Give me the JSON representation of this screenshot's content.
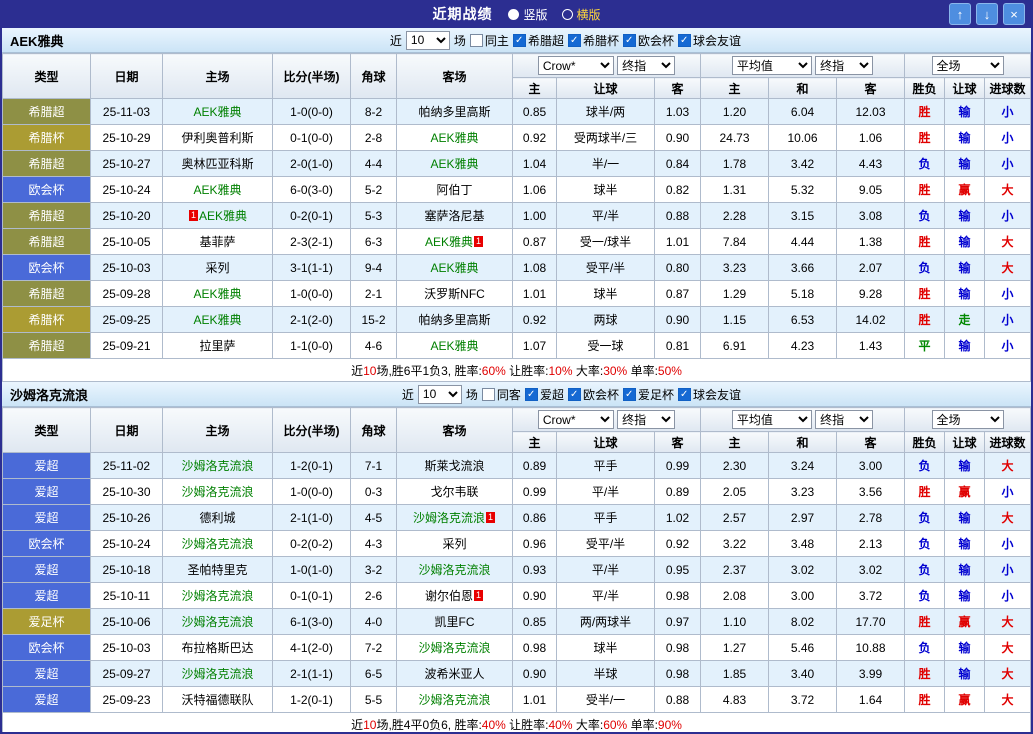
{
  "titlebar": {
    "title": "近期战绩",
    "vertical": "竖版",
    "horizontal": "横版",
    "up_icon": "↑",
    "down_icon": "↓",
    "close_icon": "×"
  },
  "table_header": {
    "cols": [
      "类型",
      "日期",
      "主场",
      "比分(半场)",
      "角球",
      "客场"
    ],
    "sub": [
      "主",
      "让球",
      "客",
      "主",
      "和",
      "客",
      "胜负",
      "让球",
      "进球数"
    ],
    "selects": {
      "crow": "Crow*",
      "final1": "终指",
      "avg": "平均值",
      "final2": "终指",
      "full": "全场"
    }
  },
  "colors": {
    "titlebar": "#2c2e91",
    "league_olive": "#8e9045",
    "league_gold": "#ab9c33",
    "league_blue": "#4a6ad8",
    "focal_team": "#008000",
    "win_red": "#e00000",
    "loss_blue": "#0000d0",
    "draw_green": "#008800"
  },
  "sections": [
    {
      "team": "AEK雅典",
      "filter": {
        "near": "近",
        "count": "10",
        "games": "场",
        "same": "同主",
        "leagues": [
          "希腊超",
          "希腊杯",
          "欧会杯",
          "球会友谊"
        ]
      },
      "rows": [
        {
          "type": "希腊超",
          "tc": "t-olive",
          "date": "25-11-03",
          "home": "AEK雅典",
          "hc": "focal",
          "score": "1-0(0-0)",
          "corners": "8-2",
          "away": "帕纳多里高斯",
          "h": "0.85",
          "hcap": "球半/两",
          "a": "1.03",
          "m1": "1.20",
          "m2": "6.04",
          "m3": "12.03",
          "r": "胜",
          "rc": "res-r",
          "l": "输",
          "lc": "res-b",
          "g": "小",
          "gc": "res-b"
        },
        {
          "type": "希腊杯",
          "tc": "t-gold",
          "date": "25-10-29",
          "home": "伊利奥普利斯",
          "score": "0-1(0-0)",
          "corners": "2-8",
          "away": "AEK雅典",
          "ac": "focal",
          "h": "0.92",
          "hcap": "受两球半/三",
          "a": "0.90",
          "m1": "24.73",
          "m2": "10.06",
          "m3": "1.06",
          "r": "胜",
          "rc": "res-r",
          "l": "输",
          "lc": "res-b",
          "g": "小",
          "gc": "res-b"
        },
        {
          "type": "希腊超",
          "tc": "t-olive",
          "date": "25-10-27",
          "home": "奥林匹亚科斯",
          "score": "2-0(1-0)",
          "corners": "4-4",
          "away": "AEK雅典",
          "ac": "focal",
          "h": "1.04",
          "hcap": "半/一",
          "a": "0.84",
          "m1": "1.78",
          "m2": "3.42",
          "m3": "4.43",
          "r": "负",
          "rc": "res-b",
          "l": "输",
          "lc": "res-b",
          "g": "小",
          "gc": "res-b"
        },
        {
          "type": "欧会杯",
          "tc": "t-blue",
          "date": "25-10-24",
          "home": "AEK雅典",
          "hc": "focal",
          "score": "6-0(3-0)",
          "corners": "5-2",
          "away": "阿伯丁",
          "h": "1.06",
          "hcap": "球半",
          "a": "0.82",
          "m1": "1.31",
          "m2": "5.32",
          "m3": "9.05",
          "r": "胜",
          "rc": "res-r",
          "l": "赢",
          "lc": "res-r",
          "g": "大",
          "gc": "res-r"
        },
        {
          "type": "希腊超",
          "tc": "t-olive",
          "date": "25-10-20",
          "hpre": "1",
          "home": "AEK雅典",
          "hc": "focal",
          "score": "0-2(0-1)",
          "corners": "5-3",
          "away": "塞萨洛尼基",
          "h": "1.00",
          "hcap": "平/半",
          "a": "0.88",
          "m1": "2.28",
          "m2": "3.15",
          "m3": "3.08",
          "r": "负",
          "rc": "res-b",
          "l": "输",
          "lc": "res-b",
          "g": "小",
          "gc": "res-b"
        },
        {
          "type": "希腊超",
          "tc": "t-olive",
          "date": "25-10-05",
          "home": "基菲萨",
          "score": "2-3(2-1)",
          "corners": "6-3",
          "away": "AEK雅典",
          "ac": "focal",
          "apost": "1",
          "h": "0.87",
          "hcap": "受一/球半",
          "a": "1.01",
          "m1": "7.84",
          "m2": "4.44",
          "m3": "1.38",
          "r": "胜",
          "rc": "res-r",
          "l": "输",
          "lc": "res-b",
          "g": "大",
          "gc": "res-r"
        },
        {
          "type": "欧会杯",
          "tc": "t-blue",
          "date": "25-10-03",
          "home": "采列",
          "score": "3-1(1-1)",
          "corners": "9-4",
          "away": "AEK雅典",
          "ac": "focal",
          "h": "1.08",
          "hcap": "受平/半",
          "a": "0.80",
          "m1": "3.23",
          "m2": "3.66",
          "m3": "2.07",
          "r": "负",
          "rc": "res-b",
          "l": "输",
          "lc": "res-b",
          "g": "大",
          "gc": "res-r"
        },
        {
          "type": "希腊超",
          "tc": "t-olive",
          "date": "25-09-28",
          "home": "AEK雅典",
          "hc": "focal",
          "score": "1-0(0-0)",
          "corners": "2-1",
          "away": "沃罗斯NFC",
          "h": "1.01",
          "hcap": "球半",
          "a": "0.87",
          "m1": "1.29",
          "m2": "5.18",
          "m3": "9.28",
          "r": "胜",
          "rc": "res-r",
          "l": "输",
          "lc": "res-b",
          "g": "小",
          "gc": "res-b"
        },
        {
          "type": "希腊杯",
          "tc": "t-gold",
          "date": "25-09-25",
          "home": "AEK雅典",
          "hc": "focal",
          "score": "2-1(2-0)",
          "corners": "15-2",
          "away": "帕纳多里高斯",
          "h": "0.92",
          "hcap": "两球",
          "a": "0.90",
          "m1": "1.15",
          "m2": "6.53",
          "m3": "14.02",
          "r": "胜",
          "rc": "res-r",
          "l": "走",
          "lc": "res-g",
          "g": "小",
          "gc": "res-b"
        },
        {
          "type": "希腊超",
          "tc": "t-olive",
          "date": "25-09-21",
          "home": "拉里萨",
          "score": "1-1(0-0)",
          "corners": "4-6",
          "away": "AEK雅典",
          "ac": "focal",
          "h": "1.07",
          "hcap": "受一球",
          "a": "0.81",
          "m1": "6.91",
          "m2": "4.23",
          "m3": "1.43",
          "r": "平",
          "rc": "res-g",
          "l": "输",
          "lc": "res-b",
          "g": "小",
          "gc": "res-b"
        }
      ],
      "summary": [
        "近",
        "10",
        "场,胜6平1负3, 胜率:",
        "60%",
        " 让胜率:",
        "10%",
        " 大率:",
        "30%",
        " 单率:",
        "50%"
      ]
    },
    {
      "team": "沙姆洛克流浪",
      "filter": {
        "near": "近",
        "count": "10",
        "games": "场",
        "same": "同客",
        "leagues": [
          "爱超",
          "欧会杯",
          "爱足杯",
          "球会友谊"
        ]
      },
      "rows": [
        {
          "type": "爱超",
          "tc": "t-blue",
          "date": "25-11-02",
          "home": "沙姆洛克流浪",
          "hc": "focal",
          "score": "1-2(0-1)",
          "corners": "7-1",
          "away": "斯莱戈流浪",
          "h": "0.89",
          "hcap": "平手",
          "a": "0.99",
          "m1": "2.30",
          "m2": "3.24",
          "m3": "3.00",
          "r": "负",
          "rc": "res-b",
          "l": "输",
          "lc": "res-b",
          "g": "大",
          "gc": "res-r"
        },
        {
          "type": "爱超",
          "tc": "t-blue",
          "date": "25-10-30",
          "home": "沙姆洛克流浪",
          "hc": "focal",
          "score": "1-0(0-0)",
          "corners": "0-3",
          "away": "戈尔韦联",
          "h": "0.99",
          "hcap": "平/半",
          "a": "0.89",
          "m1": "2.05",
          "m2": "3.23",
          "m3": "3.56",
          "r": "胜",
          "rc": "res-r",
          "l": "赢",
          "lc": "res-r",
          "g": "小",
          "gc": "res-b"
        },
        {
          "type": "爱超",
          "tc": "t-blue",
          "date": "25-10-26",
          "home": "德利城",
          "score": "2-1(1-0)",
          "corners": "4-5",
          "away": "沙姆洛克流浪",
          "ac": "focal",
          "apost": "1",
          "h": "0.86",
          "hcap": "平手",
          "a": "1.02",
          "m1": "2.57",
          "m2": "2.97",
          "m3": "2.78",
          "r": "负",
          "rc": "res-b",
          "l": "输",
          "lc": "res-b",
          "g": "大",
          "gc": "res-r"
        },
        {
          "type": "欧会杯",
          "tc": "t-blue",
          "date": "25-10-24",
          "home": "沙姆洛克流浪",
          "hc": "focal",
          "score": "0-2(0-2)",
          "corners": "4-3",
          "away": "采列",
          "h": "0.96",
          "hcap": "受平/半",
          "a": "0.92",
          "m1": "3.22",
          "m2": "3.48",
          "m3": "2.13",
          "r": "负",
          "rc": "res-b",
          "l": "输",
          "lc": "res-b",
          "g": "小",
          "gc": "res-b"
        },
        {
          "type": "爱超",
          "tc": "t-blue",
          "date": "25-10-18",
          "home": "圣帕特里克",
          "score": "1-0(1-0)",
          "corners": "3-2",
          "away": "沙姆洛克流浪",
          "ac": "focal",
          "h": "0.93",
          "hcap": "平/半",
          "a": "0.95",
          "m1": "2.37",
          "m2": "3.02",
          "m3": "3.02",
          "r": "负",
          "rc": "res-b",
          "l": "输",
          "lc": "res-b",
          "g": "小",
          "gc": "res-b"
        },
        {
          "type": "爱超",
          "tc": "t-blue",
          "date": "25-10-11",
          "home": "沙姆洛克流浪",
          "hc": "focal",
          "score": "0-1(0-1)",
          "corners": "2-6",
          "away": "谢尔伯恩",
          "apost": "1",
          "h": "0.90",
          "hcap": "平/半",
          "a": "0.98",
          "m1": "2.08",
          "m2": "3.00",
          "m3": "3.72",
          "r": "负",
          "rc": "res-b",
          "l": "输",
          "lc": "res-b",
          "g": "小",
          "gc": "res-b"
        },
        {
          "type": "爱足杯",
          "tc": "t-gold",
          "date": "25-10-06",
          "home": "沙姆洛克流浪",
          "hc": "focal",
          "score": "6-1(3-0)",
          "corners": "4-0",
          "away": "凯里FC",
          "h": "0.85",
          "hcap": "两/两球半",
          "a": "0.97",
          "m1": "1.10",
          "m2": "8.02",
          "m3": "17.70",
          "r": "胜",
          "rc": "res-r",
          "l": "赢",
          "lc": "res-r",
          "g": "大",
          "gc": "res-r"
        },
        {
          "type": "欧会杯",
          "tc": "t-blue",
          "date": "25-10-03",
          "home": "布拉格斯巴达",
          "score": "4-1(2-0)",
          "corners": "7-2",
          "away": "沙姆洛克流浪",
          "ac": "focal",
          "h": "0.98",
          "hcap": "球半",
          "a": "0.98",
          "m1": "1.27",
          "m2": "5.46",
          "m3": "10.88",
          "r": "负",
          "rc": "res-b",
          "l": "输",
          "lc": "res-b",
          "g": "大",
          "gc": "res-r"
        },
        {
          "type": "爱超",
          "tc": "t-blue",
          "date": "25-09-27",
          "home": "沙姆洛克流浪",
          "hc": "focal",
          "score": "2-1(1-1)",
          "corners": "6-5",
          "away": "波希米亚人",
          "h": "0.90",
          "hcap": "半球",
          "a": "0.98",
          "m1": "1.85",
          "m2": "3.40",
          "m3": "3.99",
          "r": "胜",
          "rc": "res-r",
          "l": "输",
          "lc": "res-b",
          "g": "大",
          "gc": "res-r"
        },
        {
          "type": "爱超",
          "tc": "t-blue",
          "date": "25-09-23",
          "home": "沃特福德联队",
          "score": "1-2(0-1)",
          "corners": "5-5",
          "away": "沙姆洛克流浪",
          "ac": "focal",
          "h": "1.01",
          "hcap": "受半/一",
          "a": "0.88",
          "m1": "4.83",
          "m2": "3.72",
          "m3": "1.64",
          "r": "胜",
          "rc": "res-r",
          "l": "赢",
          "lc": "res-r",
          "g": "大",
          "gc": "res-r"
        }
      ],
      "summary": [
        "近",
        "10",
        "场,胜4平0负6, 胜率:",
        "40%",
        " 让胜率:",
        "40%",
        " 大率:",
        "60%",
        " 单率:",
        "90%"
      ]
    }
  ]
}
